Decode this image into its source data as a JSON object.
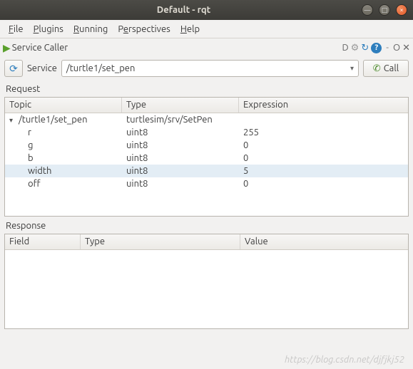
{
  "window": {
    "title": "Default - rqt"
  },
  "menu": {
    "file": "File",
    "plugins": "Plugins",
    "running": "Running",
    "perspectives": "Perspectives",
    "help": "Help"
  },
  "plugin": {
    "title": "Service Caller"
  },
  "service_row": {
    "label": "Service",
    "value": "/turtle1/set_pen",
    "call_label": "Call"
  },
  "request": {
    "label": "Request",
    "headers": {
      "topic": "Topic",
      "type": "Type",
      "expression": "Expression"
    },
    "root": {
      "topic": "/turtle1/set_pen",
      "type": "turtlesim/srv/SetPen",
      "expression": ""
    },
    "rows": [
      {
        "topic": "r",
        "type": "uint8",
        "expression": "255",
        "selected": false
      },
      {
        "topic": "g",
        "type": "uint8",
        "expression": "0",
        "selected": false
      },
      {
        "topic": "b",
        "type": "uint8",
        "expression": "0",
        "selected": false
      },
      {
        "topic": "width",
        "type": "uint8",
        "expression": "5",
        "selected": true
      },
      {
        "topic": "off",
        "type": "uint8",
        "expression": "0",
        "selected": false
      }
    ]
  },
  "response": {
    "label": "Response",
    "headers": {
      "field": "Field",
      "type": "Type",
      "value": "Value"
    }
  },
  "watermark": "https://blog.csdn.net/djfjkj52"
}
